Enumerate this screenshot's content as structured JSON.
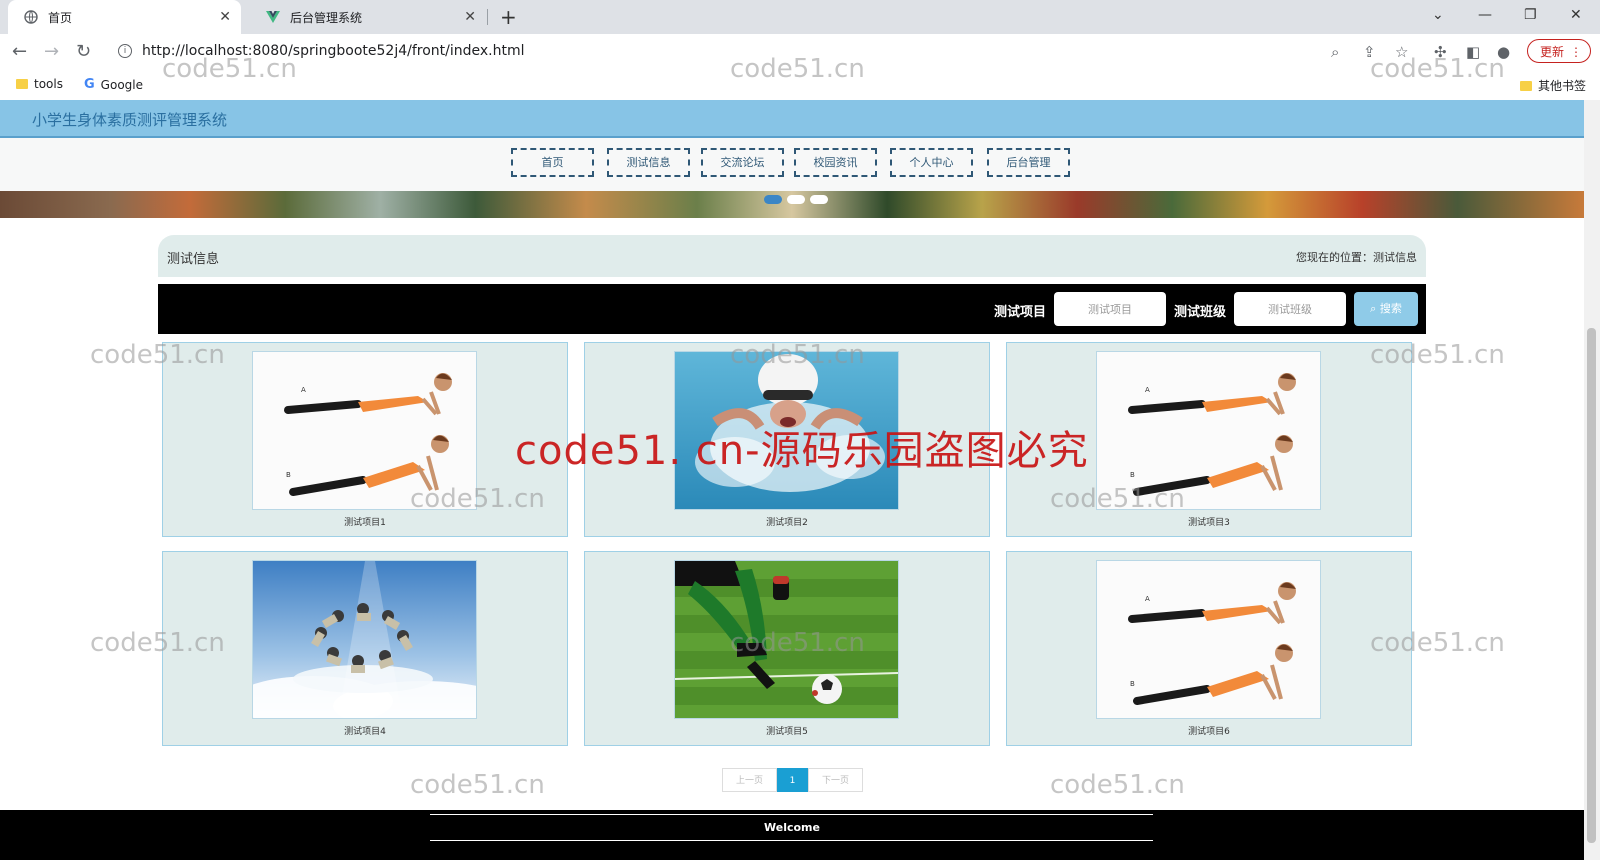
{
  "browser": {
    "tabs": [
      {
        "title": "首页",
        "active": true
      },
      {
        "title": "后台管理系统",
        "active": false
      }
    ],
    "url": "http://localhost:8080/springboote52j4/front/index.html",
    "update_label": "更新",
    "bookmarks": [
      {
        "label": "tools",
        "icon": "folder-icon"
      },
      {
        "label": "Google",
        "icon": "google-icon"
      }
    ],
    "other_bookmarks": "其他书签"
  },
  "site": {
    "title": "小学生身体素质测评管理系统",
    "nav": [
      "首页",
      "测试信息",
      "交流论坛",
      "校园资讯",
      "个人中心",
      "后台管理"
    ],
    "banner_slides": 3,
    "banner_active": 0
  },
  "section": {
    "title": "测试信息",
    "location": "您现在的位置：测试信息"
  },
  "search": {
    "field1_label": "测试项目",
    "field1_placeholder": "测试项目",
    "field2_label": "测试班级",
    "field2_placeholder": "测试班级",
    "button_label": "搜索"
  },
  "items": [
    {
      "name": "测试项目1",
      "image": "plank-exercise"
    },
    {
      "name": "测试项目2",
      "image": "swimmer"
    },
    {
      "name": "测试项目3",
      "image": "plank-exercise"
    },
    {
      "name": "测试项目4",
      "image": "skydivers"
    },
    {
      "name": "测试项目5",
      "image": "soccer-kick"
    },
    {
      "name": "测试项目6",
      "image": "plank-exercise"
    }
  ],
  "pagination": {
    "prev": "上一页",
    "current": "1",
    "next": "下一页"
  },
  "footer": {
    "text": "Welcome"
  },
  "watermarks": {
    "small": "code51.cn",
    "large": "code51. cn-源码乐园盗图必究"
  },
  "colors": {
    "header_bg": "#87c4e6",
    "nav_border": "#2f5876",
    "card_bg": "#e0eceb",
    "search_button": "#8fcbe8",
    "pager_active": "#1a9fd3",
    "watermark_red": "#c81414"
  }
}
